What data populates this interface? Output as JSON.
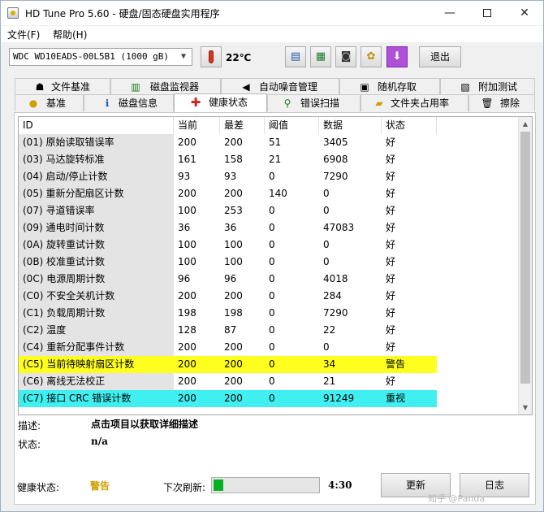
{
  "title": "HD Tune Pro 5.60 - 硬盘/固态硬盘实用程序",
  "window_buttons": {
    "minimize": "—",
    "close": "✕"
  },
  "menu": [
    "文件(F)",
    "帮助(H)"
  ],
  "toolbar": {
    "drive": "WDC WD10EADS-00L5B1 (1000 gB)",
    "temperature": "22℃",
    "exit_label": "退出"
  },
  "tabs_row1": [
    "文件基准",
    "磁盘监视器",
    "自动噪音管理",
    "随机存取",
    "附加测试"
  ],
  "tabs_row2": [
    "基准",
    "磁盘信息",
    "健康状态",
    "错误扫描",
    "文件夹占用率",
    "擦除"
  ],
  "active_tab": "健康状态",
  "columns": [
    "ID",
    "当前",
    "最差",
    "阈值",
    "数据",
    "状态"
  ],
  "rows": [
    [
      "(01) 原始读取错误率",
      "200",
      "200",
      "51",
      "3405",
      "好"
    ],
    [
      "(03) 马达旋转标准",
      "161",
      "158",
      "21",
      "6908",
      "好"
    ],
    [
      "(04) 启动/停止计数",
      "93",
      "93",
      "0",
      "7290",
      "好"
    ],
    [
      "(05) 重新分配扇区计数",
      "200",
      "200",
      "140",
      "0",
      "好"
    ],
    [
      "(07) 寻道错误率",
      "100",
      "253",
      "0",
      "0",
      "好"
    ],
    [
      "(09) 通电时间计数",
      "36",
      "36",
      "0",
      "47083",
      "好"
    ],
    [
      "(0A) 旋转重试计数",
      "100",
      "100",
      "0",
      "0",
      "好"
    ],
    [
      "(0B) 校准重试计数",
      "100",
      "100",
      "0",
      "0",
      "好"
    ],
    [
      "(0C) 电源周期计数",
      "96",
      "96",
      "0",
      "4018",
      "好"
    ],
    [
      "(C0) 不安全关机计数",
      "200",
      "200",
      "0",
      "284",
      "好"
    ],
    [
      "(C1) 负载周期计数",
      "198",
      "198",
      "0",
      "7290",
      "好"
    ],
    [
      "(C2) 温度",
      "128",
      "87",
      "0",
      "22",
      "好"
    ],
    [
      "(C4) 重新分配事件计数",
      "200",
      "200",
      "0",
      "0",
      "好"
    ],
    [
      "(C5) 当前待映射扇区计数",
      "200",
      "200",
      "0",
      "34",
      "警告"
    ],
    [
      "(C6) 离线无法校正",
      "200",
      "200",
      "0",
      "21",
      "好"
    ],
    [
      "(C7) 接口 CRC 错误计数",
      "200",
      "200",
      "0",
      "91249",
      "重视"
    ]
  ],
  "highlight_colors": {
    "warning": "#ffff20",
    "attention": "#40f0f0"
  },
  "info": {
    "description_label": "描述:",
    "description_value": "点击项目以获取详细描述",
    "status_label": "状态:",
    "status_value": "n/a"
  },
  "footer": {
    "health_label": "健康状态:",
    "health_value": "警告",
    "refresh_label": "下次刷新:",
    "refresh_progress": 0.09,
    "refresh_time": "4:30",
    "update_button": "更新",
    "log_button": "日志"
  },
  "watermark": "知乎 @Panda"
}
